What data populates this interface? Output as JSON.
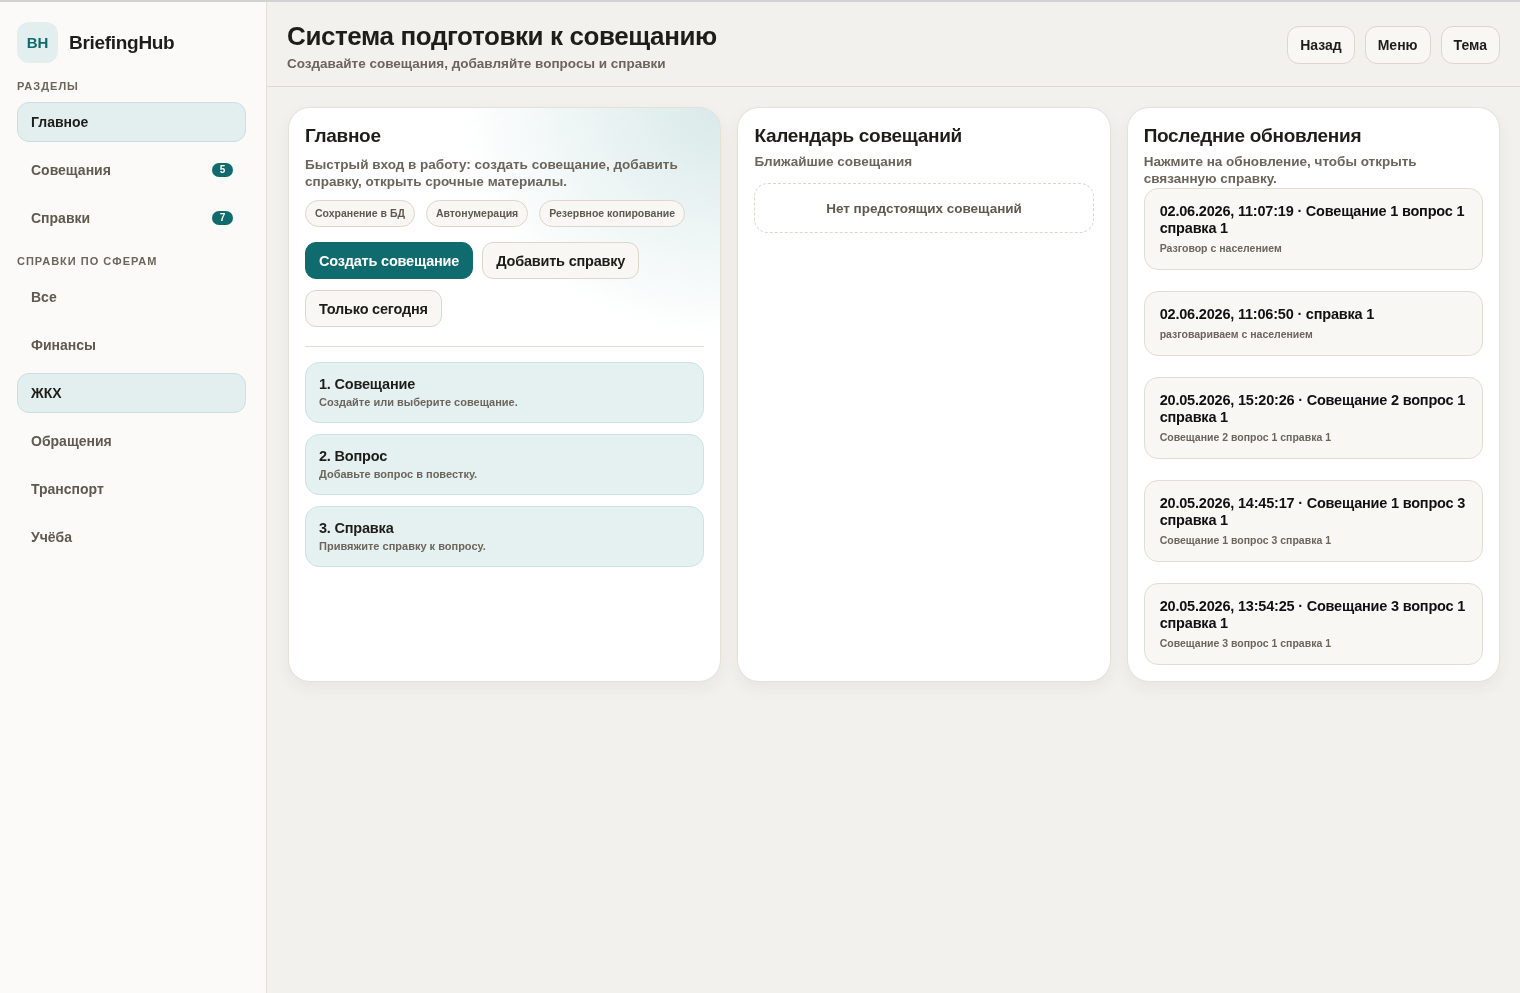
{
  "sidebar": {
    "logo": {
      "initials": "BH",
      "name": "BriefingHub"
    },
    "sections": [
      {
        "label": "РАЗДЕЛЫ",
        "items": [
          {
            "label": "Главное",
            "selected": true
          },
          {
            "label": "Совещания",
            "selected": false,
            "badge": "5"
          },
          {
            "label": "Справки",
            "selected": false,
            "badge": "7"
          }
        ]
      },
      {
        "label": "СПРАВКИ ПО СФЕРАМ",
        "items": [
          {
            "label": "Все",
            "selected": false
          },
          {
            "label": "Финансы",
            "selected": false
          },
          {
            "label": "ЖКХ",
            "selected": true
          },
          {
            "label": "Обращения",
            "selected": false
          },
          {
            "label": "Транспорт",
            "selected": false
          },
          {
            "label": "Учёба",
            "selected": false
          }
        ]
      }
    ]
  },
  "header": {
    "title": "Система подготовки к совещанию",
    "subtitle": "Создавайте совещания, добавляйте вопросы и справки",
    "buttons": [
      "Назад",
      "Меню",
      "Тема"
    ]
  },
  "home_panel": {
    "title": "Главное",
    "description": "Быстрый вход в работу: создать совещание, добавить справку, открыть срочные материалы.",
    "tags": [
      "Сохранение в БД",
      "Автонумерация",
      "Резервное копирование"
    ],
    "actions": [
      {
        "label": "Создать совещание",
        "primary": true
      },
      {
        "label": "Добавить справку",
        "primary": false
      },
      {
        "label": "Только сегодня",
        "primary": false
      }
    ],
    "steps": [
      {
        "title": "1. Совещание",
        "text": "Создайте или выберите совещание."
      },
      {
        "title": "2. Вопрос",
        "text": "Добавьте вопрос в повестку."
      },
      {
        "title": "3. Справка",
        "text": "Привяжите справку к вопросу."
      }
    ]
  },
  "calendar_panel": {
    "title": "Календарь совещаний",
    "subtitle": "Ближайшие совещания",
    "empty_message": "Нет предстоящих совещаний"
  },
  "updates_panel": {
    "title": "Последние обновления",
    "description": "Нажмите на обновление, чтобы открыть связанную справку.",
    "updates": [
      {
        "title": "02.06.2026, 11:07:19 · Совещание 1 вопрос 1 справка 1",
        "text": "Разговор с населением"
      },
      {
        "title": "02.06.2026, 11:06:50 · справка 1",
        "text": "разговариваем с населением"
      },
      {
        "title": "20.05.2026, 15:20:26 · Совещание 2 вопрос 1 справка 1",
        "text": "Совещание 2 вопрос 1 справка 1"
      },
      {
        "title": "20.05.2026, 14:45:17 · Совещание 1 вопрос 3 справка 1",
        "text": "Совещание 1 вопрос 3 справка 1"
      },
      {
        "title": "20.05.2026, 13:54:25 · Совещание 3 вопрос 1 справка 1",
        "text": "Совещание 3 вопрос 1 справка 1"
      }
    ]
  }
}
